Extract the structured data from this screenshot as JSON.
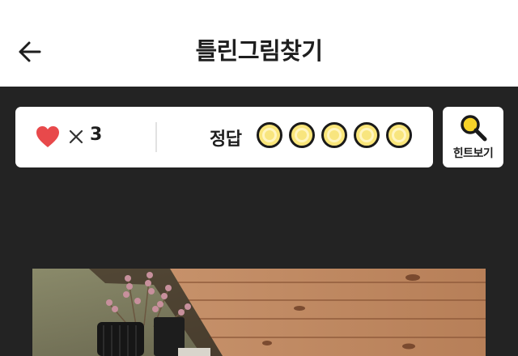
{
  "header": {
    "title": "틀린그림찾기",
    "back_icon": "arrow-left-icon"
  },
  "status": {
    "lives_icon": "heart-icon",
    "lives_color": "#e8494b",
    "multiply_icon": "times-icon",
    "lives_count": "3",
    "answer_label": "정답",
    "answers_total": 5,
    "answers_found": 0,
    "answer_slot_color": "#fae67a"
  },
  "hint_button": {
    "label": "힌트보기",
    "icon": "magnifier-icon",
    "icon_color": "#f6d329"
  },
  "puzzle": {
    "image": "puzzle-photo"
  }
}
